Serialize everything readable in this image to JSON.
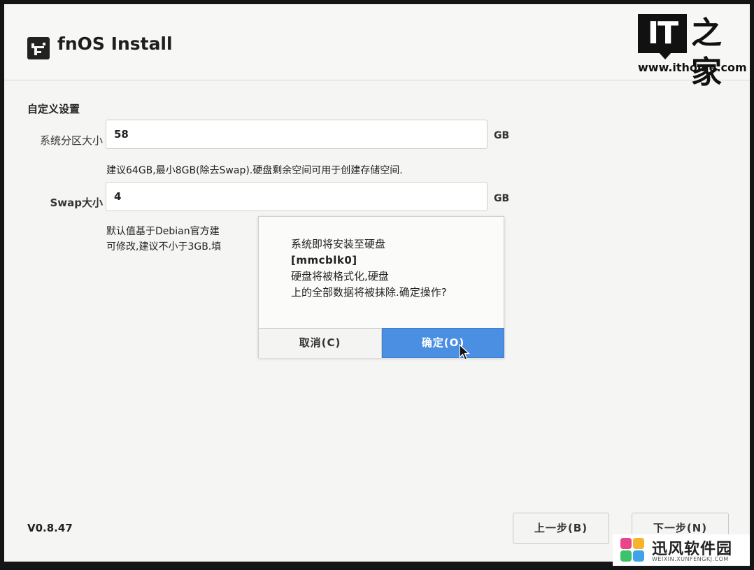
{
  "header": {
    "app_title": "fnOS Install",
    "logo_icon": "fnos-logo-icon"
  },
  "watermark_top": {
    "brand_box": "IT",
    "brand_char": "之家",
    "url": "www.ithome.com"
  },
  "form": {
    "section_title": "自定义设置",
    "system_partition": {
      "label": "系统分区大小",
      "value": "58",
      "unit": "GB",
      "hint": "建议64GB,最小8GB(除去Swap).硬盘剩余空间可用于创建存储空间."
    },
    "swap": {
      "label": "Swap大小",
      "value": "4",
      "unit": "GB",
      "hint_line1": "默认值基于Debian官方建",
      "hint_line2": "可修改,建议不小于3GB.填"
    }
  },
  "dialog": {
    "line1": "系统即将安装至硬盘",
    "device": "[mmcblk0]",
    "line3": "硬盘将被格式化,硬盘",
    "line4": "上的全部数据将被抹除.确定操作?",
    "cancel_label": "取消(C)",
    "ok_label": "确定(O)",
    "ok_color": "#4a8fe2"
  },
  "footer": {
    "version": "V0.8.47",
    "prev_label": "上一步(B)",
    "next_label": "下一步(N)"
  },
  "watermark_bottom": {
    "name": "迅风软件园",
    "url": "WEIXIN.XUNFENGKJ.COM"
  }
}
